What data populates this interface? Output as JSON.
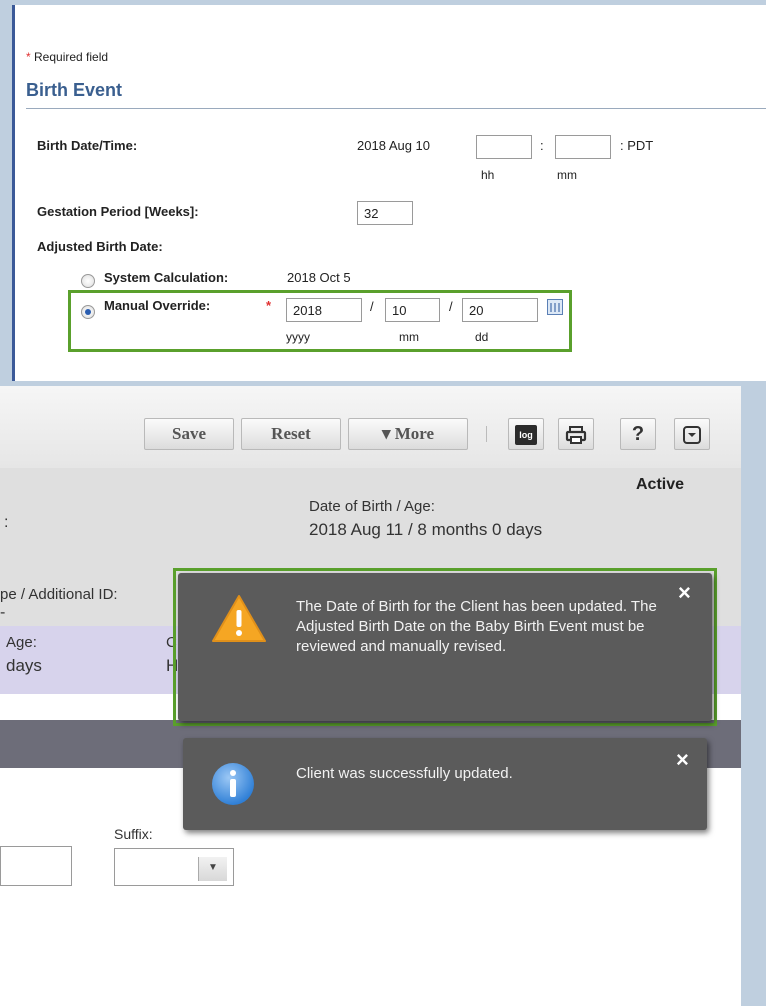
{
  "birth_event": {
    "required_note": "Required field",
    "required_star": "*",
    "section_title": "Birth Event",
    "birth_datetime_label": "Birth Date/Time:",
    "birth_date_value": "2018 Aug 10",
    "hh_value": "",
    "mm_value": "",
    "colon": ":",
    "tz_label": ": PDT",
    "hh_caption": "hh",
    "mm_caption": "mm",
    "gestation_label": "Gestation Period [Weeks]:",
    "gestation_value": "32",
    "adjusted_label": "Adjusted Birth Date:",
    "system_calc_label": "System Calculation:",
    "system_calc_value": "2018 Oct 5",
    "manual_override_label": "Manual Override:",
    "manual_star": "*",
    "override_year": "2018",
    "override_month": "10",
    "override_day": "20",
    "slash": "/",
    "yyyy_caption": "yyyy",
    "mm2_caption": "mm",
    "dd_caption": "dd",
    "selected_option": "manual_override"
  },
  "client_panel": {
    "toolbar": {
      "save_label": "Save",
      "reset_label": "Reset",
      "more_label": "▾ More",
      "log_label": "log",
      "help_label": "?"
    },
    "status": "Active",
    "left_colon": ":",
    "dob_label": "Date of Birth / Age:",
    "dob_value": "2018 Aug 11 / 8 months 0 days",
    "type_label_partial": "pe / Additional ID:",
    "dash": "-",
    "age_label_partial": "Age:",
    "age_value_partial": "days",
    "c_partial": "C",
    "h_partial": "H",
    "suffix_label": "Suffix:",
    "suffix_value": ""
  },
  "notifications": [
    {
      "type": "warning",
      "icon": "warning-triangle-icon",
      "message": "The Date of Birth for the Client has been updated. The Adjusted Birth Date on the Baby Birth Event must be reviewed and manually revised.",
      "close": "×"
    },
    {
      "type": "info",
      "icon": "info-circle-icon",
      "message": "Client was successfully updated.",
      "close": "×"
    }
  ],
  "colors": {
    "highlight_green": "#5aa02c",
    "section_blue": "#3a5f8f",
    "toast_bg": "#5b5b5b",
    "lavender_row": "#d7d3ec",
    "dark_bar": "#6d6d79"
  }
}
